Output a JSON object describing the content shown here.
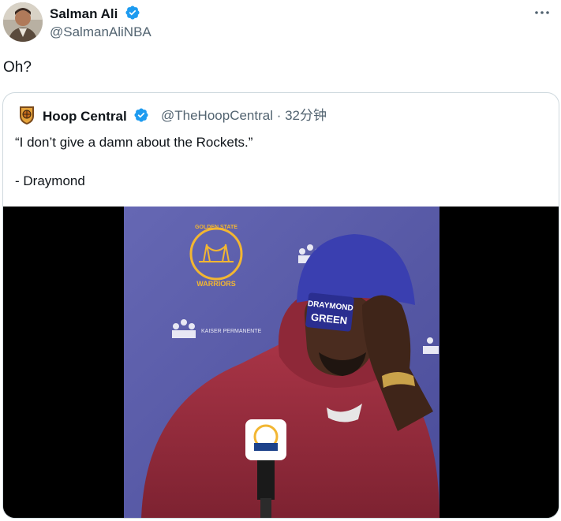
{
  "author": {
    "display_name": "Salman Ali",
    "handle": "@SalmanAliNBA",
    "avatar_icon": "avatar-photo",
    "verified_color": "#1d9bf0"
  },
  "tweet": {
    "text": "Oh?"
  },
  "quote": {
    "display_name": "Hoop Central",
    "handle_time": "@TheHoopCentral · 32分钟",
    "text": "“I don’t give a damn about the Rockets.”",
    "signature": "- Draymond"
  },
  "media": {
    "beanie_text_line1": "DRAYMOND",
    "beanie_text_line2": "GREEN",
    "backdrop_logo_top": "GOLDEN STATE",
    "backdrop_logo_bottom": "WARRIORS",
    "backdrop_sponsor": "KAISER PERMANENTE"
  },
  "colors": {
    "accent": "#1d9bf0",
    "secondary_text": "#536471",
    "backdrop": "#5d5fa8",
    "hoodie": "#9c2e3e",
    "beanie": "#3a3fb0"
  }
}
